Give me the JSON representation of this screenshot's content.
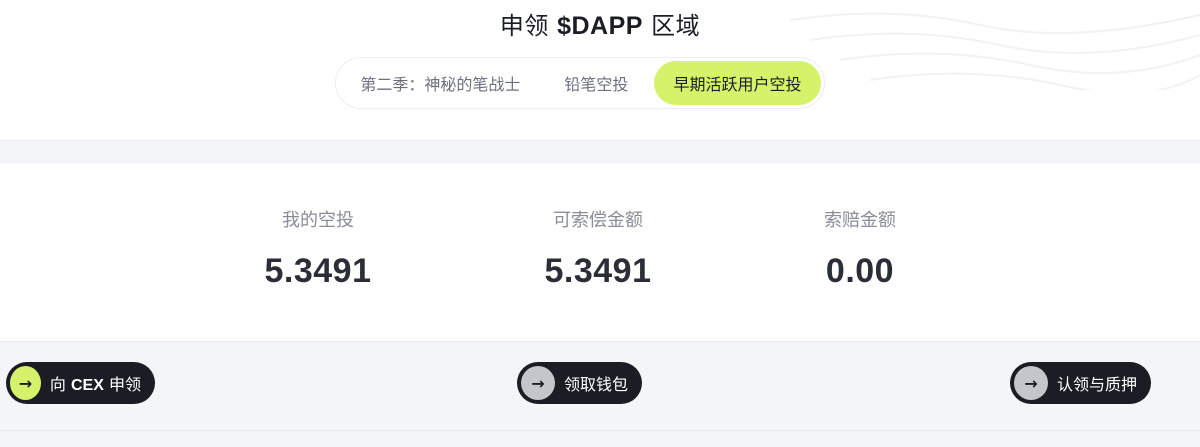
{
  "header": {
    "title_prefix": "申领 ",
    "title_token": "$DAPP",
    "title_suffix": " 区域"
  },
  "tabs": [
    {
      "label": "第二季：神秘的笔战士",
      "active": false
    },
    {
      "label": "铅笔空投",
      "active": false
    },
    {
      "label": "早期活跃用户空投",
      "active": true
    }
  ],
  "stats": [
    {
      "label": "我的空投",
      "value": "5.3491"
    },
    {
      "label": "可索偿金额",
      "value": "5.3491"
    },
    {
      "label": "索赔金额",
      "value": "0.00"
    }
  ],
  "actions": {
    "cex": {
      "prefix": "向 ",
      "bold": "CEX",
      "suffix": " 申领",
      "icon": "arrow-right-icon"
    },
    "wallet": {
      "label": "领取钱包",
      "icon": "arrow-right-icon"
    },
    "stake": {
      "label": "认领与质押",
      "icon": "arrow-right-icon"
    }
  },
  "colors": {
    "accent": "#d6f26a",
    "dark": "#1b1d24",
    "muted_circle": "#c4c6cc",
    "band": "#f4f5f8"
  }
}
